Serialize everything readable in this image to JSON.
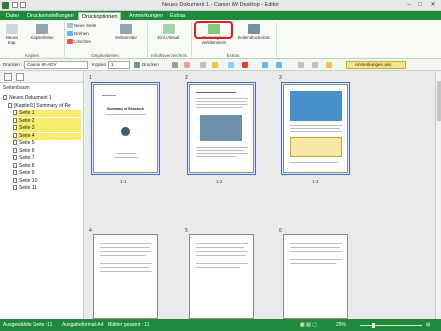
{
  "window": {
    "title": "Neues Dokument 1 - Canon iW Desktop - Editor"
  },
  "tabs": [
    {
      "label": "Datei"
    },
    {
      "label": "Druckeinstellungen"
    },
    {
      "label": "Druckoptionen"
    },
    {
      "label": "Anmerkungen"
    },
    {
      "label": "Extras"
    }
  ],
  "ribbon": {
    "neues_kap": "Neues Kap.",
    "kapitelreiter": "Kapitelreiter",
    "neue_seite": "Neue Seite",
    "drehen": "Drehen",
    "loeschen": "Löschen",
    "seitenreihenfolge": "Seitenreiter",
    "einf_aktual": "Einf./Aktual.",
    "stickoriginal": "Stickoriginal verklammern",
    "seitendruck": "Seitendruckeinst.",
    "groups": {
      "kapitel": "Kapitel",
      "originalseiten": "Originalseiten",
      "inhaltsverzeichnis": "Inhaltsverzeichnis",
      "extras": "Extras"
    }
  },
  "toolbar": {
    "drucken_label": "Drucken :",
    "printer": "Canon iR-ADV",
    "kopien_label": "Kopien",
    "kopien_value": "1",
    "drucken_button": "Drucken",
    "anmerkungen": "Anmerkungen ass."
  },
  "tree": {
    "heading": "Seitenbaum",
    "nodes": [
      {
        "label": "Neues Dokument 1",
        "indent": 0,
        "selected": false
      },
      {
        "label": "[Kapitel1] Summary of Re",
        "indent": 1,
        "selected": false
      },
      {
        "label": "Seite 1",
        "indent": 2,
        "selected": true
      },
      {
        "label": "Seite 2",
        "indent": 2,
        "selected": true
      },
      {
        "label": "Seite 3",
        "indent": 2,
        "selected": true
      },
      {
        "label": "Seite 4",
        "indent": 2,
        "selected": true
      },
      {
        "label": "Seite 5",
        "indent": 2,
        "selected": false
      },
      {
        "label": "Seite 6",
        "indent": 2,
        "selected": false
      },
      {
        "label": "Seite 7",
        "indent": 2,
        "selected": false
      },
      {
        "label": "Seite 8",
        "indent": 2,
        "selected": false
      },
      {
        "label": "Seite 9",
        "indent": 2,
        "selected": false
      },
      {
        "label": "Seite 10",
        "indent": 2,
        "selected": false
      },
      {
        "label": "Seite 11",
        "indent": 2,
        "selected": false
      }
    ]
  },
  "pages": [
    {
      "num": "1",
      "label": "1-1",
      "title": "Summary of Research"
    },
    {
      "num": "2",
      "label": "1-2",
      "title": ""
    },
    {
      "num": "3",
      "label": "1-3",
      "title": ""
    },
    {
      "num": "4",
      "label": "",
      "title": ""
    },
    {
      "num": "5",
      "label": "",
      "title": ""
    },
    {
      "num": "6",
      "label": "",
      "title": ""
    }
  ],
  "status": {
    "ausgabe_seite": "Ausgewählte Seite :11",
    "ausgabeformat": "Ausgabeformat:A4",
    "blaetter": "Blätter gesamt : 11",
    "zoom": "25%"
  },
  "colors": {
    "accent": "#1f8a3c",
    "selection": "#f8ec6e",
    "highlight": "#e0201e"
  }
}
